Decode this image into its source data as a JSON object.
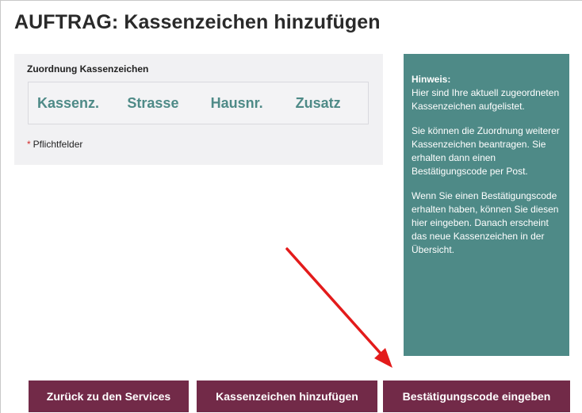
{
  "page": {
    "title": "AUFTRAG: Kassenzeichen hinzufügen"
  },
  "form": {
    "section_label": "Zuordnung Kassenzeichen",
    "table": {
      "headers": [
        "Kassenz.",
        "Strasse",
        "Hausnr.",
        "Zusatz"
      ],
      "rows": []
    },
    "required_marker": "*",
    "required_note": "Pflichtfelder"
  },
  "hint": {
    "title": "Hinweis:",
    "paragraph_1": "Hier sind Ihre aktuell zugeordneten Kassenzeichen aufgelistet.",
    "paragraph_2": "Sie können die Zuordnung weiterer Kassenzeichen beantragen. Sie erhalten dann einen Bestätigungscode per Post.",
    "paragraph_3": "Wenn Sie einen Bestätigungscode erhalten haben, können Sie diesen hier eingeben. Danach erscheint das neue Kassenzeichen in der Übersicht."
  },
  "buttons": {
    "back": "Zurück zu den Services",
    "add": "Kassenzeichen hinzufügen",
    "enter_code": "Bestätigungscode eingeben"
  },
  "colors": {
    "accent_teal": "#4e8a87",
    "button_maroon": "#722a48",
    "annotation_arrow": "#e31b1b",
    "required_star": "#d22c2c"
  },
  "annotation": {
    "arrow_icon": "red-arrow-icon",
    "points_to": "Bestätigungscode eingeben"
  }
}
